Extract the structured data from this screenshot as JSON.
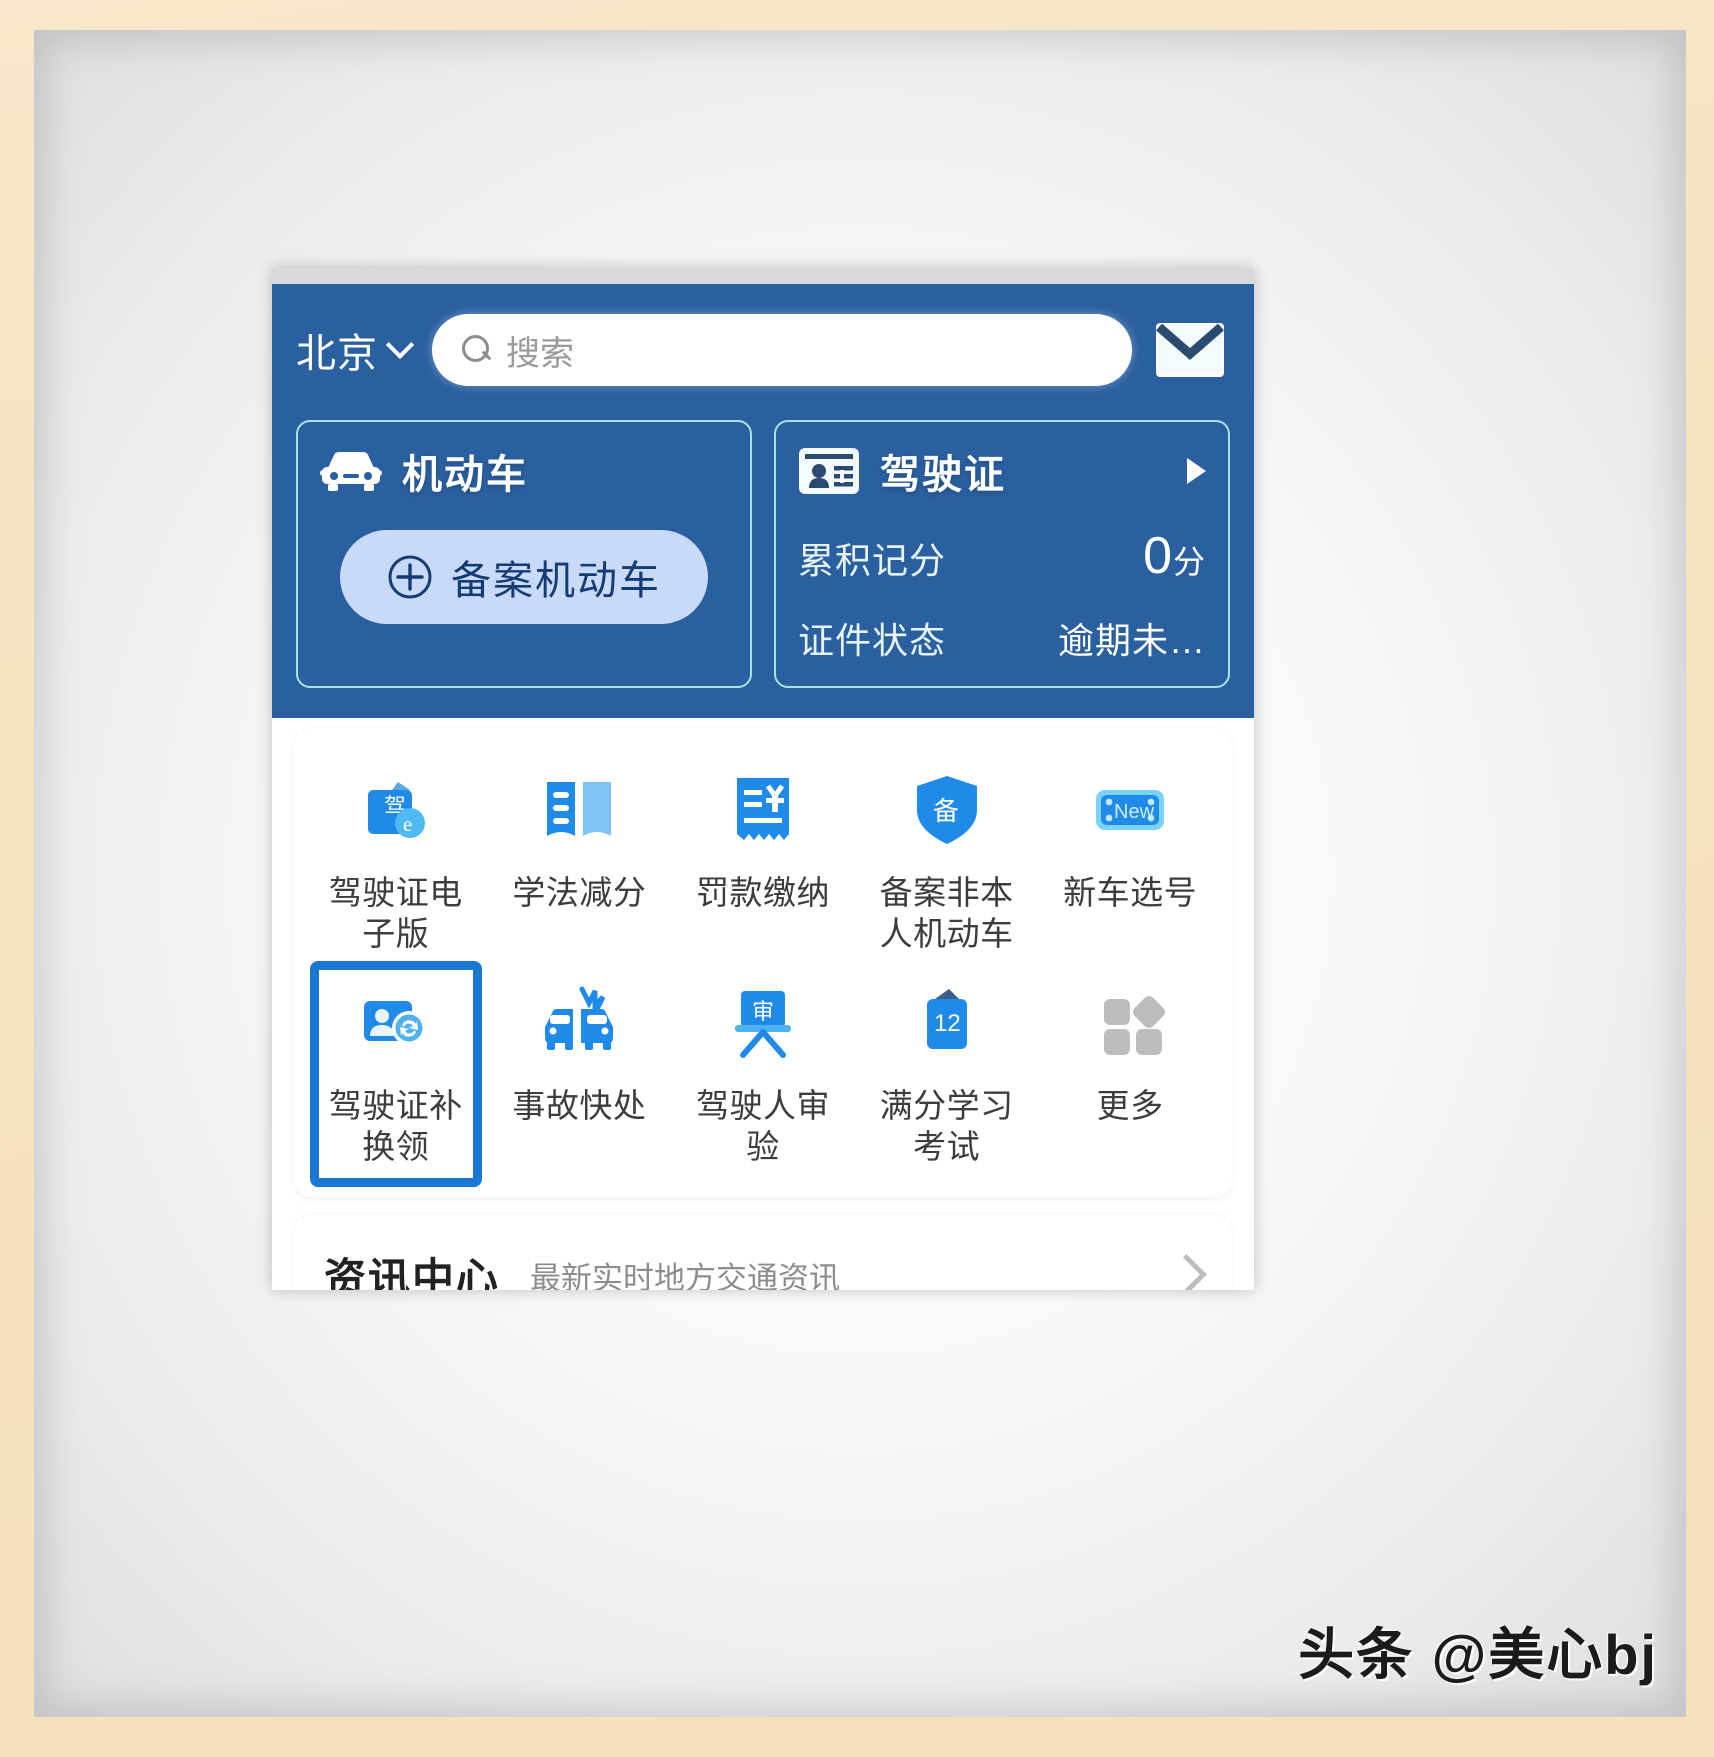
{
  "header": {
    "city": "北京",
    "city_chevron_icon": "chevron-down-icon",
    "search_placeholder": "搜索",
    "search_icon": "search-icon",
    "mail_icon": "envelope-icon"
  },
  "vehicle_card": {
    "icon": "car-icon",
    "title": "机动车",
    "action_label": "备案机动车",
    "action_icon": "plus-circle-icon"
  },
  "license_card": {
    "icon": "id-card-icon",
    "title": "驾驶证",
    "arrow_icon": "triangle-right-icon",
    "rows": [
      {
        "label": "累积记分",
        "value": "0",
        "unit": "分"
      },
      {
        "label": "证件状态",
        "value": "逾期未…",
        "unit": ""
      }
    ]
  },
  "grid": {
    "row1": [
      {
        "label": "驾驶证电子版",
        "icon": "license-ebook-icon"
      },
      {
        "label": "学法减分",
        "icon": "open-book-icon"
      },
      {
        "label": "罚款缴纳",
        "icon": "receipt-yuan-icon"
      },
      {
        "label": "备案非本人机动车",
        "icon": "shield-bei-icon"
      },
      {
        "label": "新车选号",
        "icon": "new-plate-icon",
        "icon_text": "New"
      }
    ],
    "row2": [
      {
        "label": "驾驶证补换领",
        "icon": "license-renew-icon",
        "selected": true
      },
      {
        "label": "事故快处",
        "icon": "crash-cars-icon"
      },
      {
        "label": "驾驶人审验",
        "icon": "easel-shen-icon"
      },
      {
        "label": "满分学习考试",
        "icon": "booklet-12-icon",
        "icon_text": "12"
      },
      {
        "label": "更多",
        "icon": "more-grid-icon"
      }
    ]
  },
  "news": {
    "title": "资讯中心",
    "subtitle": "最新实时地方交通资讯",
    "chevron_icon": "chevron-right-icon"
  },
  "watermark": {
    "text": "头条 @美心bj"
  },
  "colors": {
    "app_blue": "#2a5fa0",
    "card_border": "#a9e3e0",
    "accent_button": "#c9daf8",
    "highlight": "#1a77d2",
    "icon_blue": "#1f8ae8",
    "frame_cream": "#f7e3c4"
  }
}
